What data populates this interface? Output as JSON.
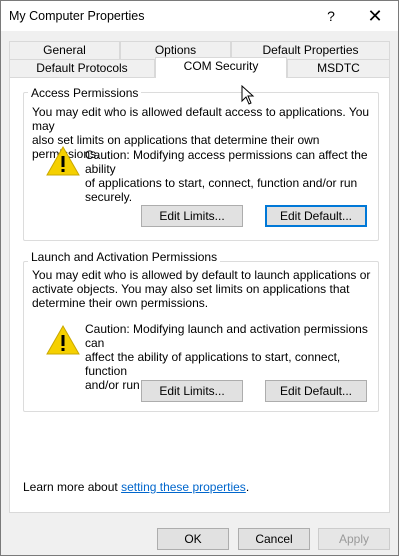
{
  "window": {
    "title": "My Computer Properties",
    "help_glyph": "?",
    "close_glyph": "✕"
  },
  "tabs": {
    "row1": [
      {
        "label": "General"
      },
      {
        "label": "Options"
      },
      {
        "label": "Default Properties"
      }
    ],
    "row2": [
      {
        "label": "Default Protocols"
      },
      {
        "label": "COM Security",
        "active": true
      },
      {
        "label": "MSDTC"
      }
    ]
  },
  "access": {
    "title": "Access Permissions",
    "description_lines": [
      "You may edit who is allowed default access to applications. You may",
      "also set limits on applications that determine their own permissions."
    ],
    "caution_lines": [
      "Caution: Modifying access permissions can affect the ability",
      "of applications to start, connect, function and/or run",
      "securely."
    ],
    "edit_limits_label": "Edit Limits...",
    "edit_default_label": "Edit Default..."
  },
  "launch": {
    "title": "Launch and Activation Permissions",
    "description_lines": [
      "You may edit who is allowed by default to launch applications or",
      "activate objects. You may also set limits on applications that",
      "determine their own permissions."
    ],
    "caution_lines": [
      "Caution: Modifying launch and activation permissions can",
      "affect the ability of applications to start, connect, function",
      "and/or run securely."
    ],
    "edit_limits_label": "Edit Limits...",
    "edit_default_label": "Edit Default..."
  },
  "learn_more": {
    "prefix": "Learn more about ",
    "link_text": "setting these properties",
    "suffix": "."
  },
  "footer": {
    "ok_label": "OK",
    "cancel_label": "Cancel",
    "apply_label": "Apply"
  },
  "colors": {
    "warning_yellow": "#f5d000",
    "link_blue": "#0066cc",
    "focus_blue": "#0078d7"
  },
  "icons": {
    "warning": "warning-icon",
    "help": "help-icon",
    "close": "close-icon",
    "cursor": "mouse-cursor-icon"
  }
}
